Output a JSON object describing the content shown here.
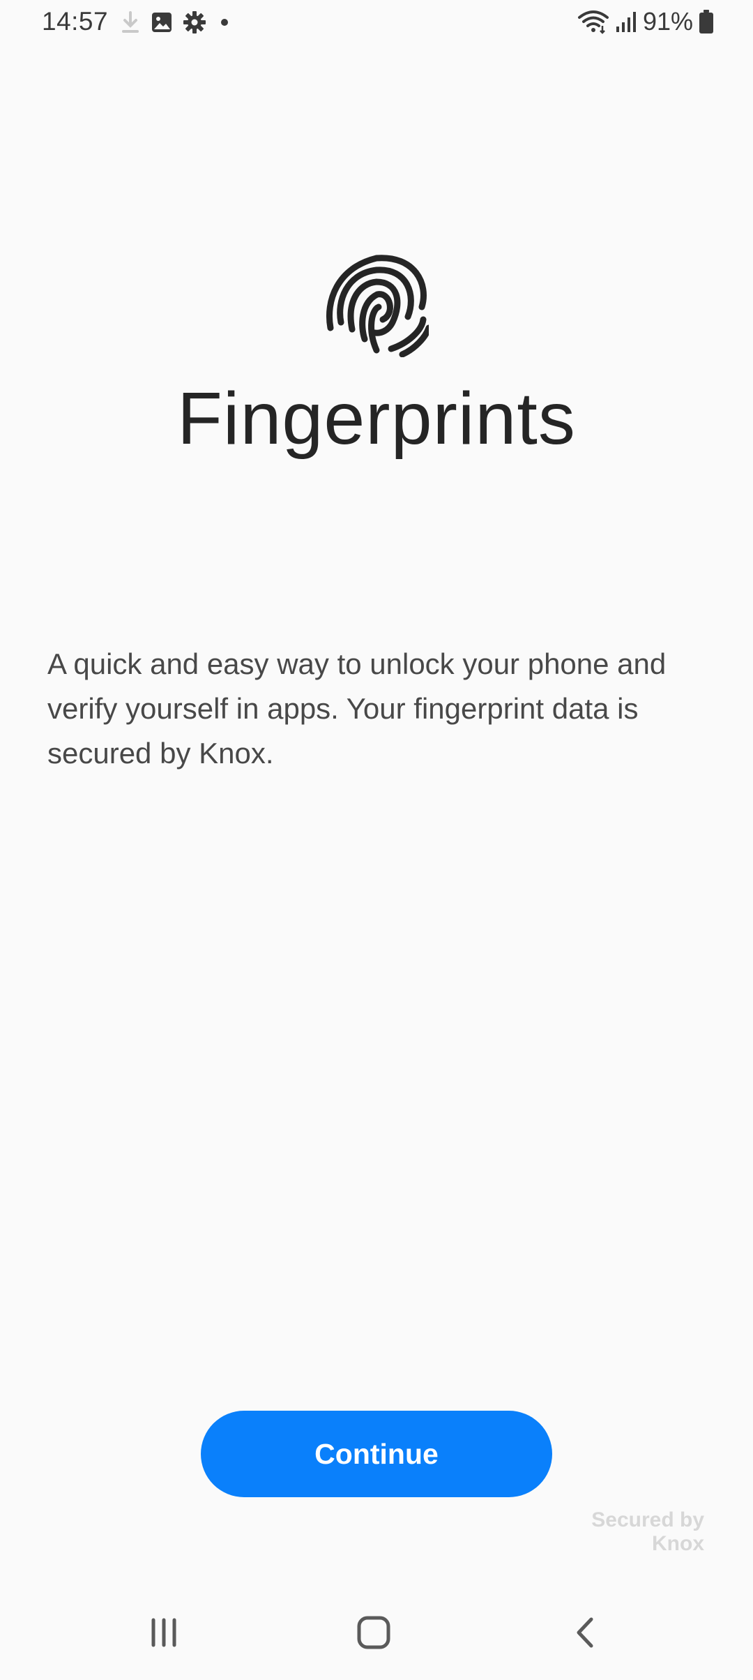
{
  "status_bar": {
    "time": "14:57",
    "battery_percent": "91%",
    "left_icons": [
      "download-icon",
      "image-icon",
      "settings-icon",
      "dot-icon"
    ],
    "right_icons": [
      "wifi-icon",
      "signal-icon",
      "battery-icon"
    ]
  },
  "main": {
    "icon": "fingerprint-icon",
    "title": "Fingerprints",
    "description": "A quick and easy way to unlock your phone and verify yourself in apps. Your fingerprint data is secured by Knox."
  },
  "actions": {
    "continue_label": "Continue"
  },
  "footer": {
    "knox_line1": "Secured by",
    "knox_line2": "Knox"
  },
  "nav_bar": {
    "buttons": [
      "recents-icon",
      "home-icon",
      "back-icon"
    ]
  },
  "colors": {
    "background": "#fafafa",
    "accent": "#0a80fb",
    "text": "#252525"
  }
}
